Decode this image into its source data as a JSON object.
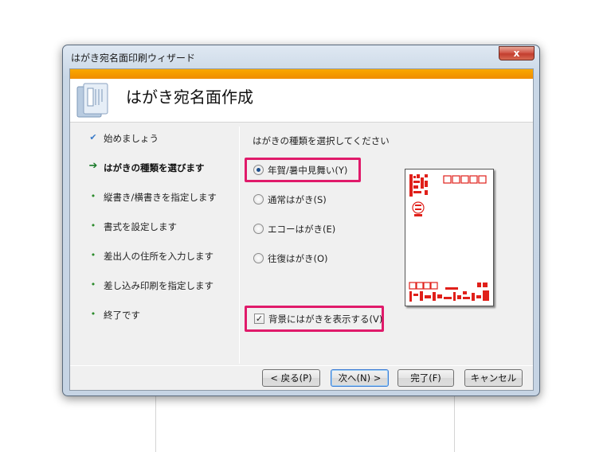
{
  "window": {
    "title": "はがき宛名面印刷ウィザード",
    "close_glyph": "x"
  },
  "header": {
    "title": "はがき宛名面作成"
  },
  "steps": [
    {
      "marker": "✔",
      "label": "始めましょう",
      "state": "done"
    },
    {
      "marker": "➔",
      "label": "はがきの種類を選びます",
      "state": "current"
    },
    {
      "marker": "•",
      "label": "縦書き/横書きを指定します",
      "state": "pending"
    },
    {
      "marker": "•",
      "label": "書式を設定します",
      "state": "pending"
    },
    {
      "marker": "•",
      "label": "差出人の住所を入力します",
      "state": "pending"
    },
    {
      "marker": "•",
      "label": "差し込み印刷を指定します",
      "state": "pending"
    },
    {
      "marker": "•",
      "label": "終了です",
      "state": "pending"
    }
  ],
  "main": {
    "prompt": "はがきの種類を選択してください",
    "options": [
      {
        "label": "年賀/暑中見舞い(Y)",
        "selected": true
      },
      {
        "label": "通常はがき(S)",
        "selected": false
      },
      {
        "label": "エコーはがき(E)",
        "selected": false
      },
      {
        "label": "往復はがき(O)",
        "selected": false
      }
    ],
    "show_background": {
      "label": "背景にはがきを表示する(V)",
      "checked": true,
      "mark": "✓"
    }
  },
  "buttons": {
    "back": "< 戻る(P)",
    "next": "次へ(N) >",
    "finish": "完了(F)",
    "cancel": "キャンセル"
  },
  "colors": {
    "highlight": "#e01a6a",
    "accent_bar": "#f29a00",
    "postcard_red": "#e0201a"
  }
}
